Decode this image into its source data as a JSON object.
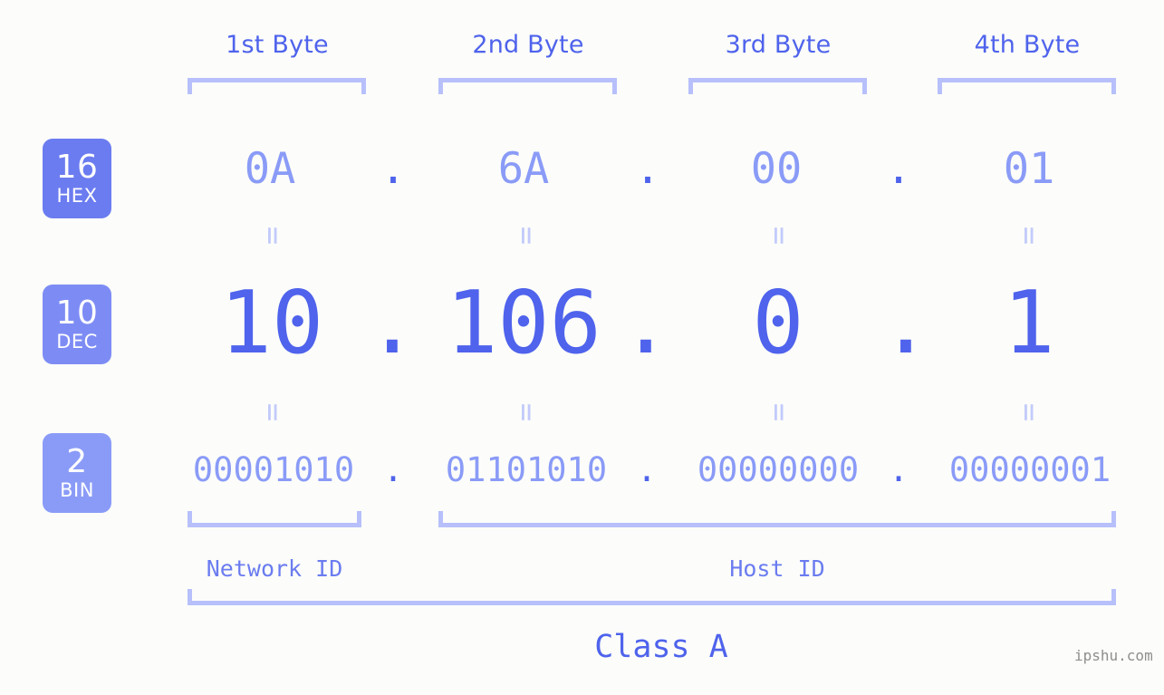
{
  "background_color": "#fcfdfa",
  "accent_color": "#4f63ec",
  "accent_light_color": "#8a9bf7",
  "bracket_color": "#b7c0fb",
  "header": {
    "byte_labels": [
      {
        "label": "1st Byte"
      },
      {
        "label": "2nd Byte"
      },
      {
        "label": "3rd Byte"
      },
      {
        "label": "4th Byte"
      }
    ]
  },
  "rows": [
    {
      "badge_number": "16",
      "badge_name": "HEX",
      "badge_color": "#6b7cf0",
      "values": [
        "0A",
        "6A",
        "00",
        "01"
      ],
      "separator": "."
    },
    {
      "badge_number": "10",
      "badge_name": "DEC",
      "badge_color": "#7d8cf4",
      "values": [
        "10",
        "106",
        "0",
        "1"
      ],
      "separator": "."
    },
    {
      "badge_number": "2",
      "badge_name": "BIN",
      "badge_color": "#8a9bf7",
      "values": [
        "00001010",
        "01101010",
        "00000000",
        "00000001"
      ],
      "separator": "."
    }
  ],
  "equals_symbol": "=",
  "footer": {
    "network_id_label": "Network ID",
    "host_id_label": "Host ID",
    "class_label": "Class A"
  },
  "watermark": "ipshu.com"
}
